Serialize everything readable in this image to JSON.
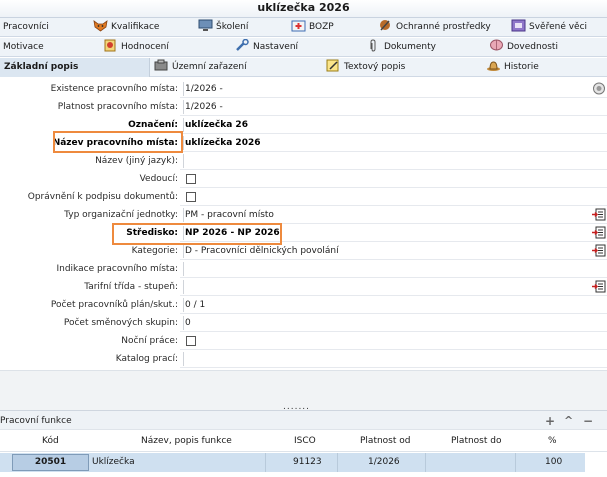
{
  "window": {
    "title": "uklízečka 2026"
  },
  "tabs_row1": [
    {
      "label": "Pracovníci",
      "icon": "none"
    },
    {
      "label": "Kvalifikace",
      "icon": "fox-icon"
    },
    {
      "label": "Školení",
      "icon": "monitor-icon"
    },
    {
      "label": "BOZP",
      "icon": "first-aid-icon"
    },
    {
      "label": "Ochranné prostředky",
      "icon": "tools-icon"
    },
    {
      "label": "Svěřené věci",
      "icon": "box-icon"
    }
  ],
  "tabs_row2": [
    {
      "label": "Motivace",
      "icon": "none"
    },
    {
      "label": "Hodnocení",
      "icon": "award-icon"
    },
    {
      "label": "Nastavení",
      "icon": "wrench-icon"
    },
    {
      "label": "Dokumenty",
      "icon": "paperclip-icon"
    },
    {
      "label": "Dovednosti",
      "icon": "brain-icon"
    }
  ],
  "tabs_row3": [
    {
      "label": "Základní popis",
      "icon": "none",
      "active": true
    },
    {
      "label": "Územní zařazení",
      "icon": "map-icon"
    },
    {
      "label": "Textový popis",
      "icon": "pencil-icon"
    },
    {
      "label": "Historie",
      "icon": "hat-icon"
    }
  ],
  "form": {
    "existence_label": "Existence pracovního místa:",
    "existence_value": "1/2026 -",
    "platnost_label": "Platnost pracovního místa:",
    "platnost_value": "1/2026 -",
    "oznaceni_label": "Označení:",
    "oznaceni_value": "uklízečka 26",
    "nazev_label": "Název pracovního místa:",
    "nazev_value": "uklízečka 2026",
    "nazev_jiny_label": "Název (jiný jazyk):",
    "vedouci_label": "Vedoucí:",
    "opravneni_label": "Oprávnění k podpisu dokumentů:",
    "typ_label": "Typ organizační jednotky:",
    "typ_value": "PM - pracovní místo",
    "stredisko_label": "Středisko:",
    "stredisko_value": "NP 2026 - NP 2026",
    "kategorie_label": "Kategorie:",
    "kategorie_value": "D - Pracovníci dělnických povolání",
    "indikace_label": "Indikace pracovního místa:",
    "tarifni_label": "Tarifní třída - stupeň:",
    "pocet_prac_label": "Počet pracovníků plán/skut.:",
    "pocet_prac_value": "0 / 1",
    "pocet_smen_label": "Počet směnových skupin:",
    "pocet_smen_value": "0",
    "nocni_label": "Noční práce:",
    "katalog_label": "Katalog prací:"
  },
  "splitter": {
    "dots": "......."
  },
  "panel": {
    "title": "Pracovní funkce",
    "add_glyph": "+",
    "collapse_glyph": "^",
    "minimize_glyph": "−",
    "columns": [
      "Kód",
      "Název, popis funkce",
      "ISCO",
      "Platnost od",
      "Platnost do",
      "%"
    ],
    "rows": [
      {
        "kod": "20501",
        "nazev": "Uklízečka",
        "isco": "91123",
        "od": "1/2026",
        "do": "",
        "pct": "100"
      }
    ]
  },
  "colors": {
    "highlight": "#ee8a3e",
    "selected_row": "#cfe0f0",
    "tab_bg": "#eef3f8"
  }
}
